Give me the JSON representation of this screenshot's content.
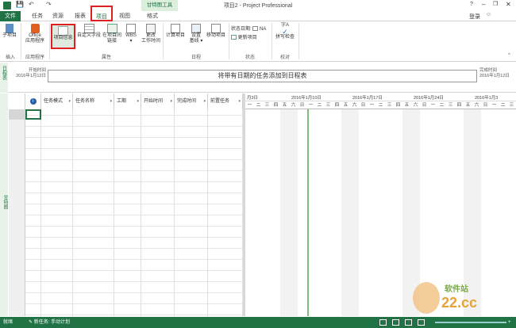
{
  "window": {
    "title": "项目2 - Project Professional",
    "context_tab_group": "甘特图工具",
    "help": "?",
    "user": "登录"
  },
  "tabs": [
    {
      "label": "文件"
    },
    {
      "label": "任务"
    },
    {
      "label": "资源"
    },
    {
      "label": "报表"
    },
    {
      "label": "项目"
    },
    {
      "label": "视图"
    },
    {
      "label": "格式"
    }
  ],
  "ribbon": {
    "insert": {
      "subproject": "子项目",
      "group": "插入"
    },
    "apps": {
      "office": "Office",
      "office2": "应用程序",
      "group": "应用程序"
    },
    "props": {
      "project_info": "项目信息",
      "custom_fields": "自定义字段",
      "links": "在项目间",
      "links2": "链接",
      "wbs": "WBS",
      "change_time": "更改",
      "change_time2": "工作时间",
      "group": "属性"
    },
    "schedule": {
      "calc": "计算项目",
      "baseline": "设置",
      "baseline2": "基线",
      "move": "移动项目",
      "group": "日程"
    },
    "status": {
      "date_label": "状态日期:",
      "date_value": "NA",
      "update": "更新项目",
      "group": "状态"
    },
    "proofing": {
      "spell": "拼写检查",
      "group": "校对"
    }
  },
  "timeline": {
    "side_label": "日程表",
    "start_label": "开始时间",
    "start_date": "2016年1月12日",
    "placeholder": "将带有日期的任务添加到日程表",
    "end_label": "完成时间",
    "end_date": "2016年1月12日"
  },
  "gantt": {
    "side_label": "甘特图",
    "columns": [
      "任务模式",
      "任务名称",
      "工期",
      "开始时间",
      "完成时间",
      "前置任务"
    ],
    "weeks": [
      "月3日",
      "2016年1月10日",
      "2016年1月17日",
      "2016年1月24日",
      "2016年1月3"
    ],
    "days": [
      "一",
      "二",
      "三",
      "四",
      "五",
      "六",
      "日"
    ]
  },
  "status_bar": {
    "ready": "就绪",
    "new_task": "新任务: 手动计划"
  },
  "watermark": {
    "text": "软件站",
    "domain": "22.cc"
  },
  "colors": {
    "accent": "#217346",
    "highlight": "#e02020"
  }
}
